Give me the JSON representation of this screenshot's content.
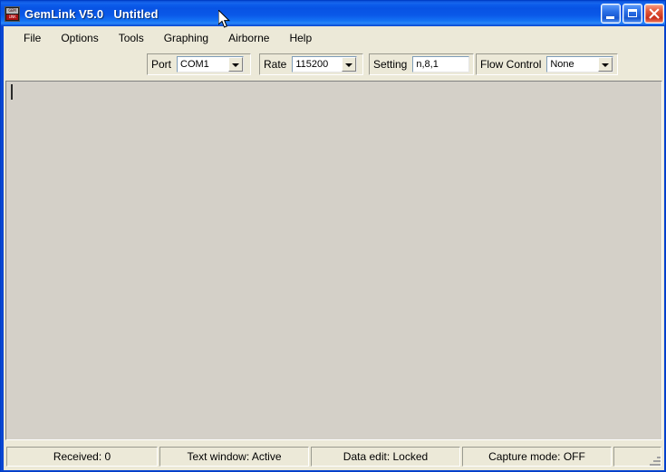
{
  "window": {
    "title": "GemLink V5.0   Untitled",
    "app_icon": "gemlink-icon",
    "icon_text_top": "GEM",
    "icon_text_bottom": "LINK",
    "controls": {
      "minimize": "minimize-button",
      "maximize": "maximize-button",
      "close": "close-button"
    },
    "titlebar_color": "#0a58e8",
    "client_color": "#ece9d8"
  },
  "menubar": {
    "items": [
      {
        "label": "File"
      },
      {
        "label": "Options"
      },
      {
        "label": "Tools"
      },
      {
        "label": "Graphing"
      },
      {
        "label": "Airborne"
      },
      {
        "label": "Help"
      }
    ]
  },
  "toolbar": {
    "port": {
      "label": "Port",
      "value": "COM1"
    },
    "rate": {
      "label": "Rate",
      "value": "115200"
    },
    "setting": {
      "label": "Setting",
      "value": "n,8,1",
      "placeholder": ""
    },
    "flow_control": {
      "label": "Flow Control",
      "value": "None"
    }
  },
  "text_window": {
    "content": "",
    "background_color": "#d4d0c8",
    "caret_visible": true
  },
  "statusbar": {
    "panels": [
      {
        "text": "Received: 0"
      },
      {
        "text": "Text window: Active"
      },
      {
        "text": "Data edit: Locked"
      },
      {
        "text": "Capture mode: OFF"
      },
      {
        "text": ""
      }
    ]
  }
}
